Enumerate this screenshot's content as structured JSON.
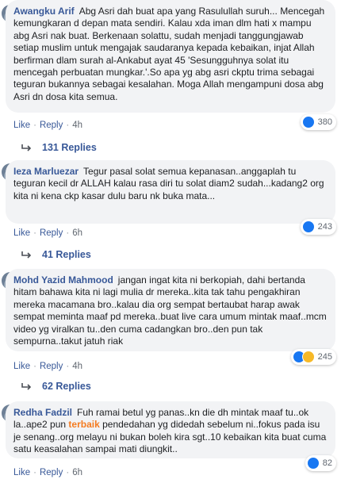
{
  "comments": [
    {
      "author": "Awangku Arif",
      "text": "Abg Asri dah buat apa yang Rasulullah suruh... Mencegah kemungkaran d depan mata sendiri. Kalau xda iman dlm hati x mampu abg Asri nak buat. Berkenaan solattu, sudah menjadi tanggungjawab setiap muslim untuk mengajak saudaranya kepada kebaikan, injat Allah berfirman dlam surah al-Ankabut ayat 45 'Sesungguhnya solat itu mencegah perbuatan mungkar.'.So apa yg abg asri ckptu trima sebagai teguran bukannya sebagai kesalahan. Moga Allah mengampuni dosa abg Asri dn dosa kita semua.",
      "like": "Like",
      "reply": "Reply",
      "time": "4h",
      "reactions": "380",
      "reaction_icons": [
        "like-icon"
      ],
      "replies": "131 Replies"
    },
    {
      "author": "Ieza Marluezar",
      "text": "Tegur pasal solat semua kepanasan..anggaplah tu teguran kecil dr ALLAH kalau rasa diri tu solat diam2 sudah...kadang2 org kita ni kena ckp kasar dulu baru nk buka mata...",
      "like": "Like",
      "reply": "Reply",
      "time": "6h",
      "reactions": "243",
      "reaction_icons": [
        "like-icon"
      ],
      "replies": "41 Replies"
    },
    {
      "author": "Mohd Yazid Mahmood",
      "text": "jangan ingat kita ni berkopiah, dahi bertanda hitam bahawa kita ni lagi mulia dr mereka..kita tak tahu pengakhiran mereka macamana bro..kalau dia org sempat bertaubat harap awak sempat meminta maaf pd mereka..buat live cara umum mintak maaf..mcm video yg viralkan tu..den cuma cadangkan bro..den pun tak sempurna..takut jatuh riak",
      "like": "Like",
      "reply": "Reply",
      "time": "4h",
      "reactions": "245",
      "reaction_icons": [
        "like-icon",
        "haha-icon"
      ],
      "replies": "62 Replies"
    },
    {
      "author": "Redha Fadzil",
      "text_before": "Fuh ramai betul yg panas..kn die dh mintak maaf tu..ok la..ape2 pun ",
      "highlight": "terbaik",
      "text_after": " pendedahan yg didedah sebelum ni..fokus pada isu je senang..org melayu ni bukan boleh kira sgt..10 kebaikan kita buat cuma satu keasalahan sampai mati diungkit..",
      "like": "Like",
      "reply": "Reply",
      "time": "6h",
      "reactions": "82",
      "reaction_icons": [
        "like-icon"
      ]
    }
  ],
  "separator": "·"
}
